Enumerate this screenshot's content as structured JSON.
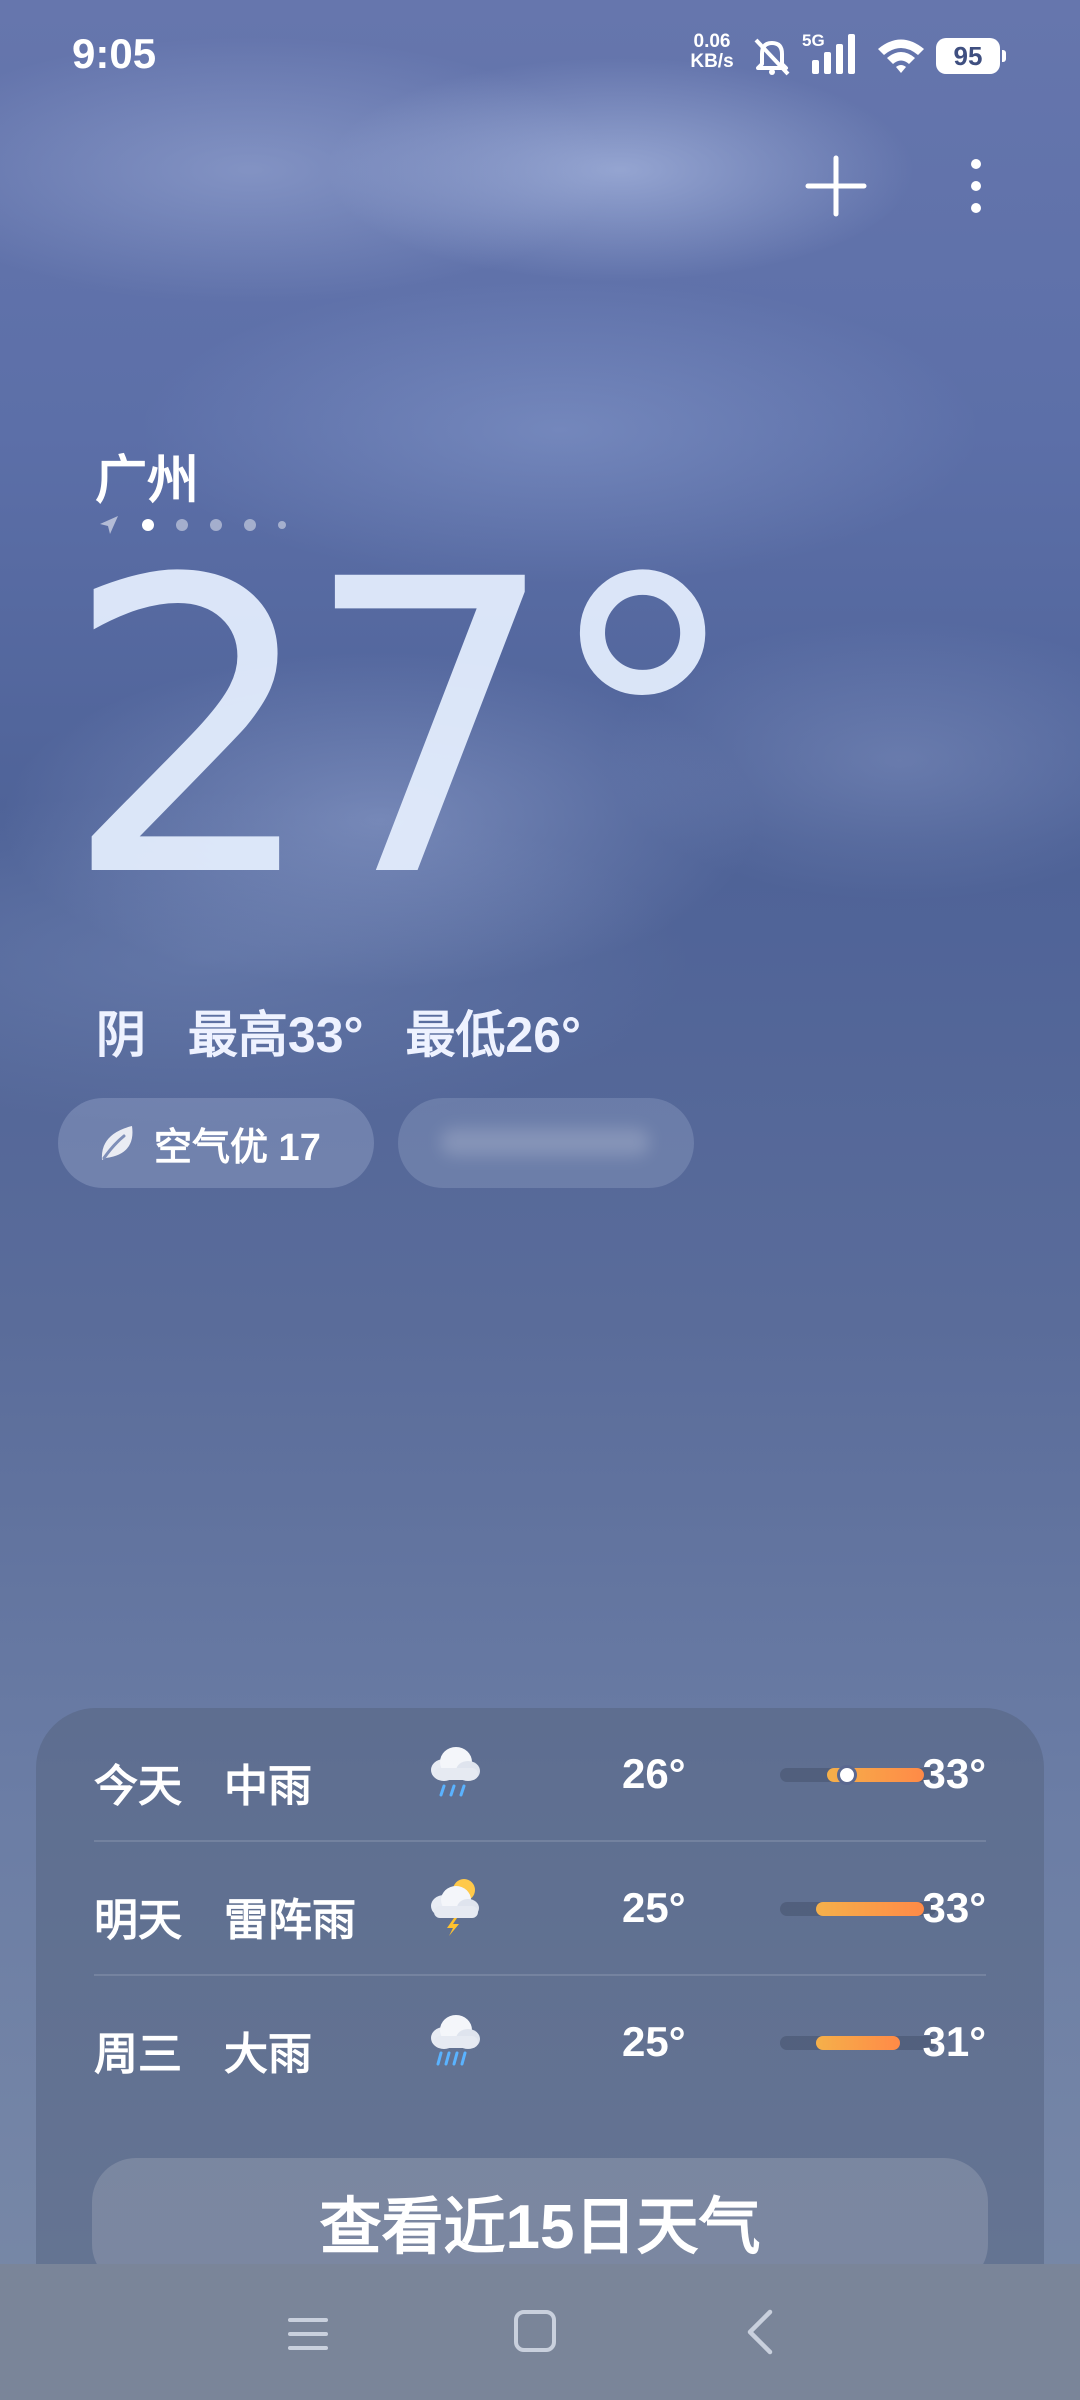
{
  "status_bar": {
    "time": "9:05",
    "net_speed_value": "0.06",
    "net_speed_unit": "KB/s",
    "network_type": "5G",
    "battery": "95"
  },
  "current": {
    "city": "广州",
    "temperature": "27°",
    "condition": "阴",
    "high": "最高33°",
    "low": "最低26°",
    "air_quality": "空气优 17"
  },
  "forecast": [
    {
      "day": "今天",
      "desc": "中雨",
      "icon": "rain-cloud-icon",
      "low": "26°",
      "high": "33°",
      "fill_start": 0.3,
      "fill_end": 0.92,
      "current_marker": 0.43
    },
    {
      "day": "明天",
      "desc": "雷阵雨",
      "icon": "thunderstorm-icon",
      "low": "25°",
      "high": "33°",
      "fill_start": 0.23,
      "fill_end": 0.92
    },
    {
      "day": "周三",
      "desc": "大雨",
      "icon": "heavy-rain-icon",
      "low": "25°",
      "high": "31°",
      "fill_start": 0.23,
      "fill_end": 0.77
    }
  ],
  "view_15_day": "查看近15日天气",
  "colors": {
    "bar_fill_start": "#f5b04a",
    "bar_fill_end": "#ff8a47"
  }
}
